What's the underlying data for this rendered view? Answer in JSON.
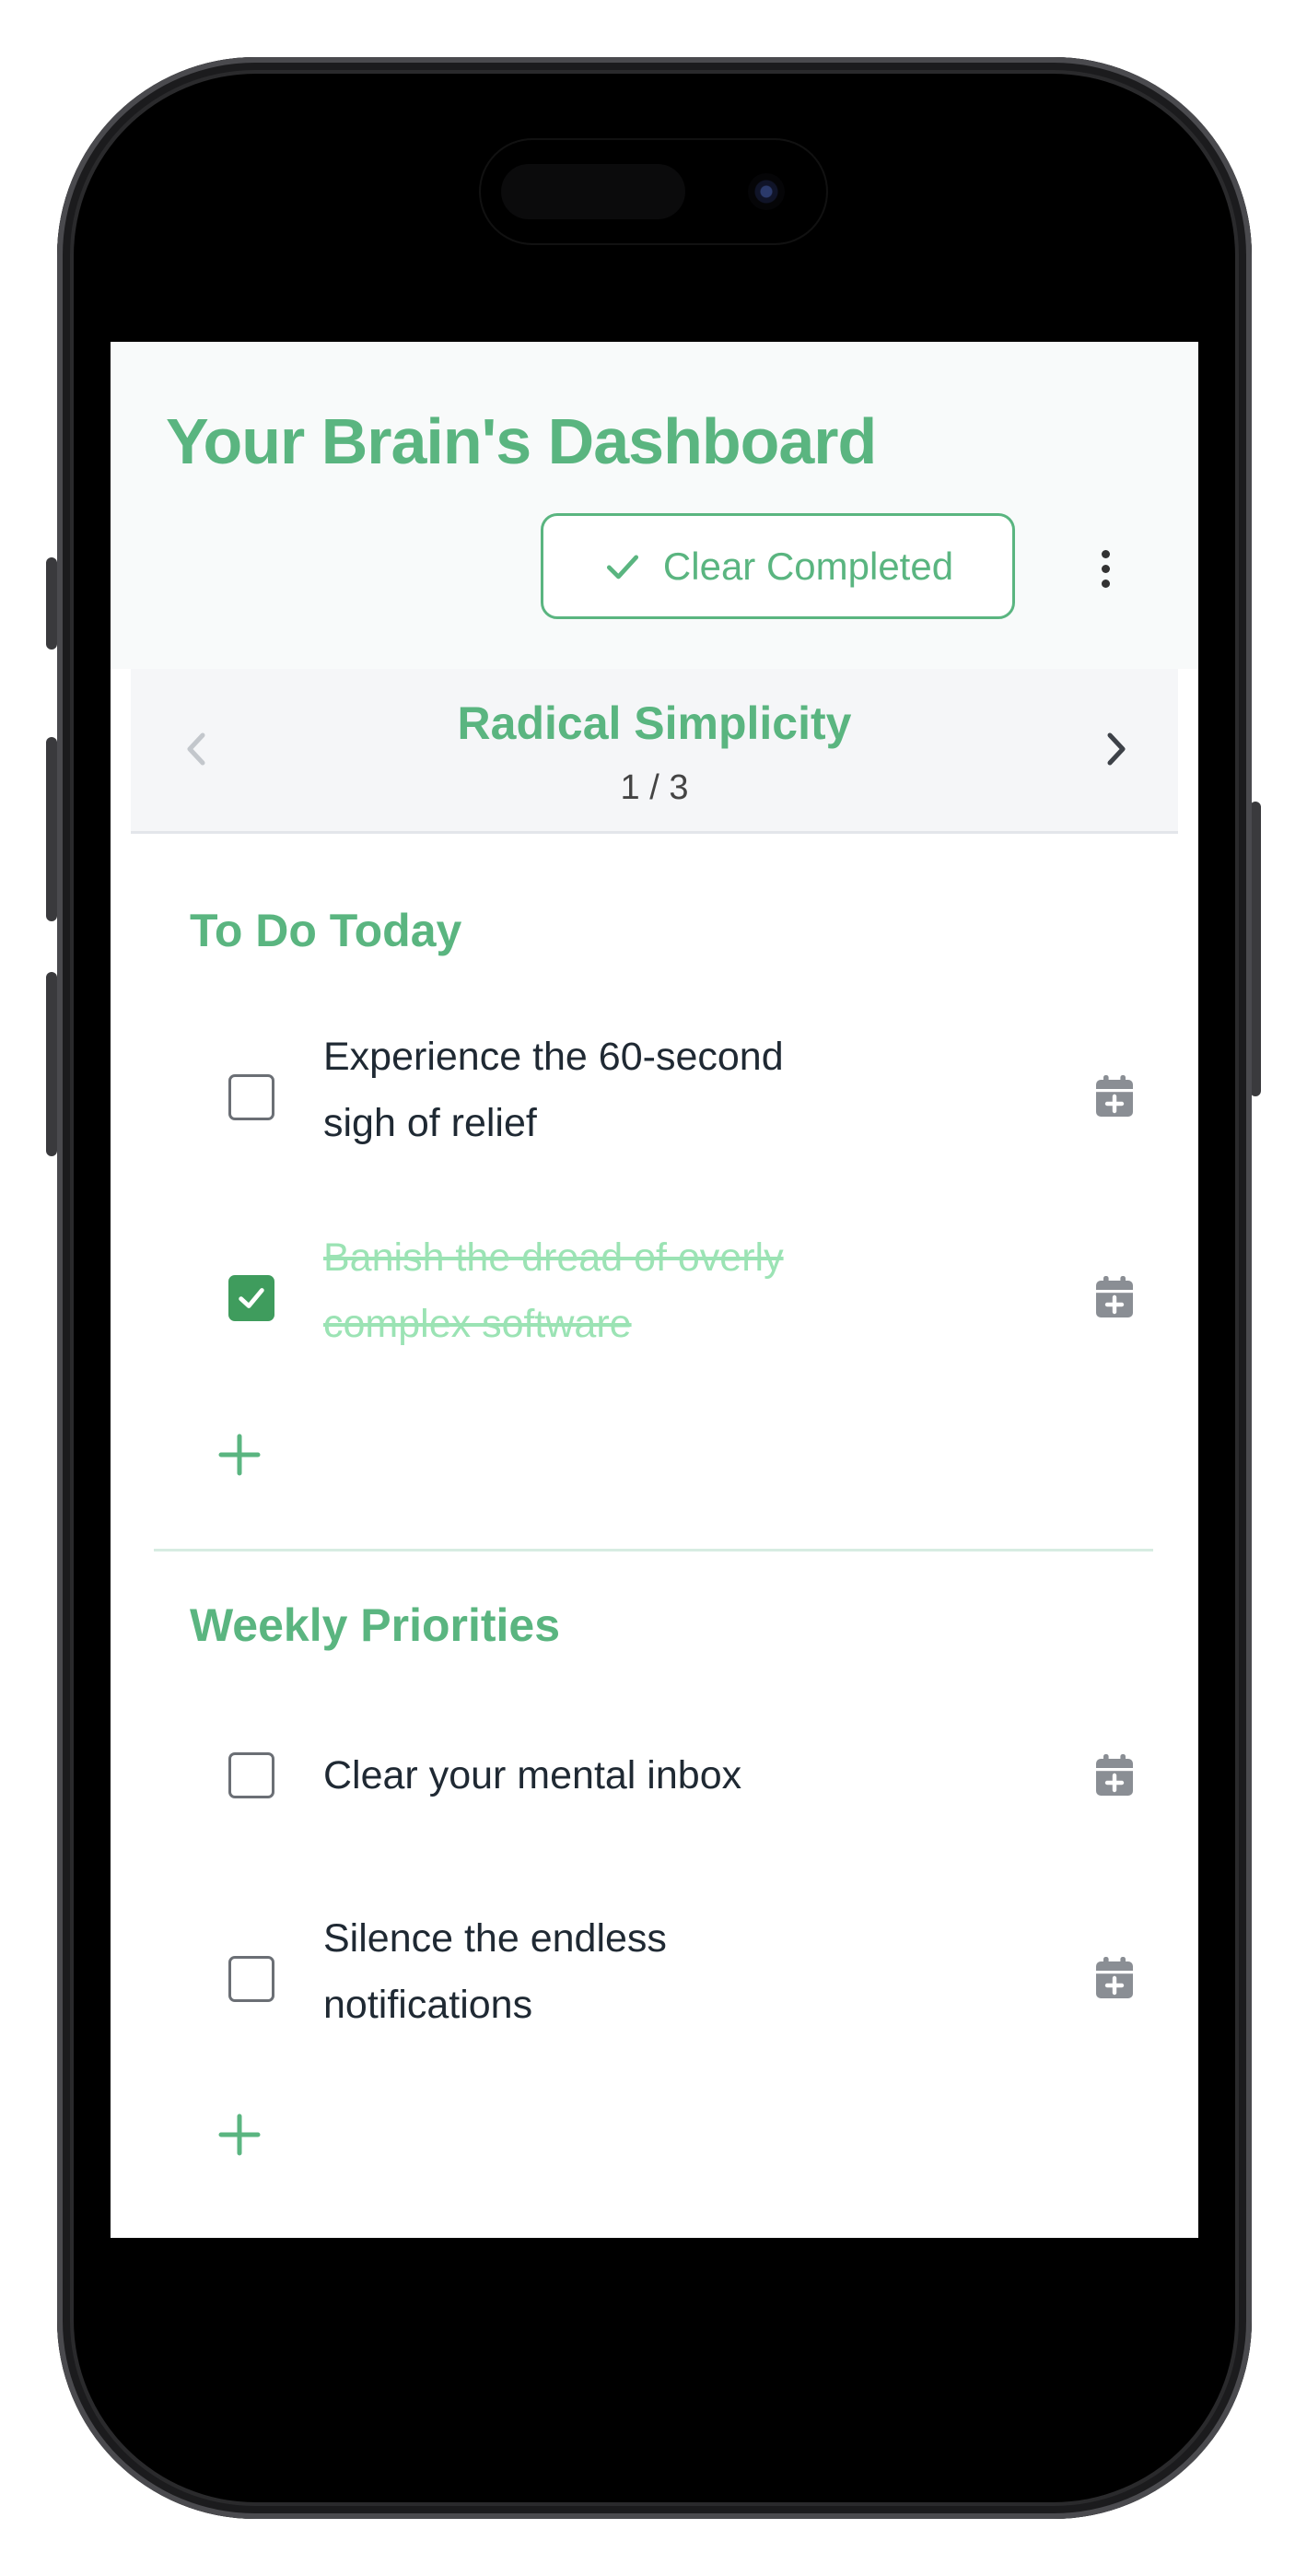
{
  "header": {
    "title": "Your Brain's Dashboard",
    "clear_completed_label": "Clear Completed"
  },
  "carousel": {
    "title": "Radical Simplicity",
    "page_indicator": "1 / 3"
  },
  "sections": [
    {
      "title": "To Do Today",
      "tasks": [
        {
          "text": "Experience the 60-second sigh of relief",
          "completed": false
        },
        {
          "text": "Banish the dread of overly complex software",
          "completed": true
        }
      ]
    },
    {
      "title": "Weekly Priorities",
      "tasks": [
        {
          "text": "Clear your mental inbox",
          "completed": false
        },
        {
          "text": "Silence the endless notifications",
          "completed": false
        }
      ]
    }
  ],
  "icons": [
    "check-icon",
    "kebab-menu-icon",
    "chevron-left-icon",
    "chevron-right-icon",
    "calendar-plus-icon",
    "plus-icon"
  ],
  "colors": {
    "accent": "#5ab580",
    "checkbox_checked": "#3f9c5d",
    "completed_text": "#9be3b4",
    "header_bg": "#f8fafa"
  }
}
